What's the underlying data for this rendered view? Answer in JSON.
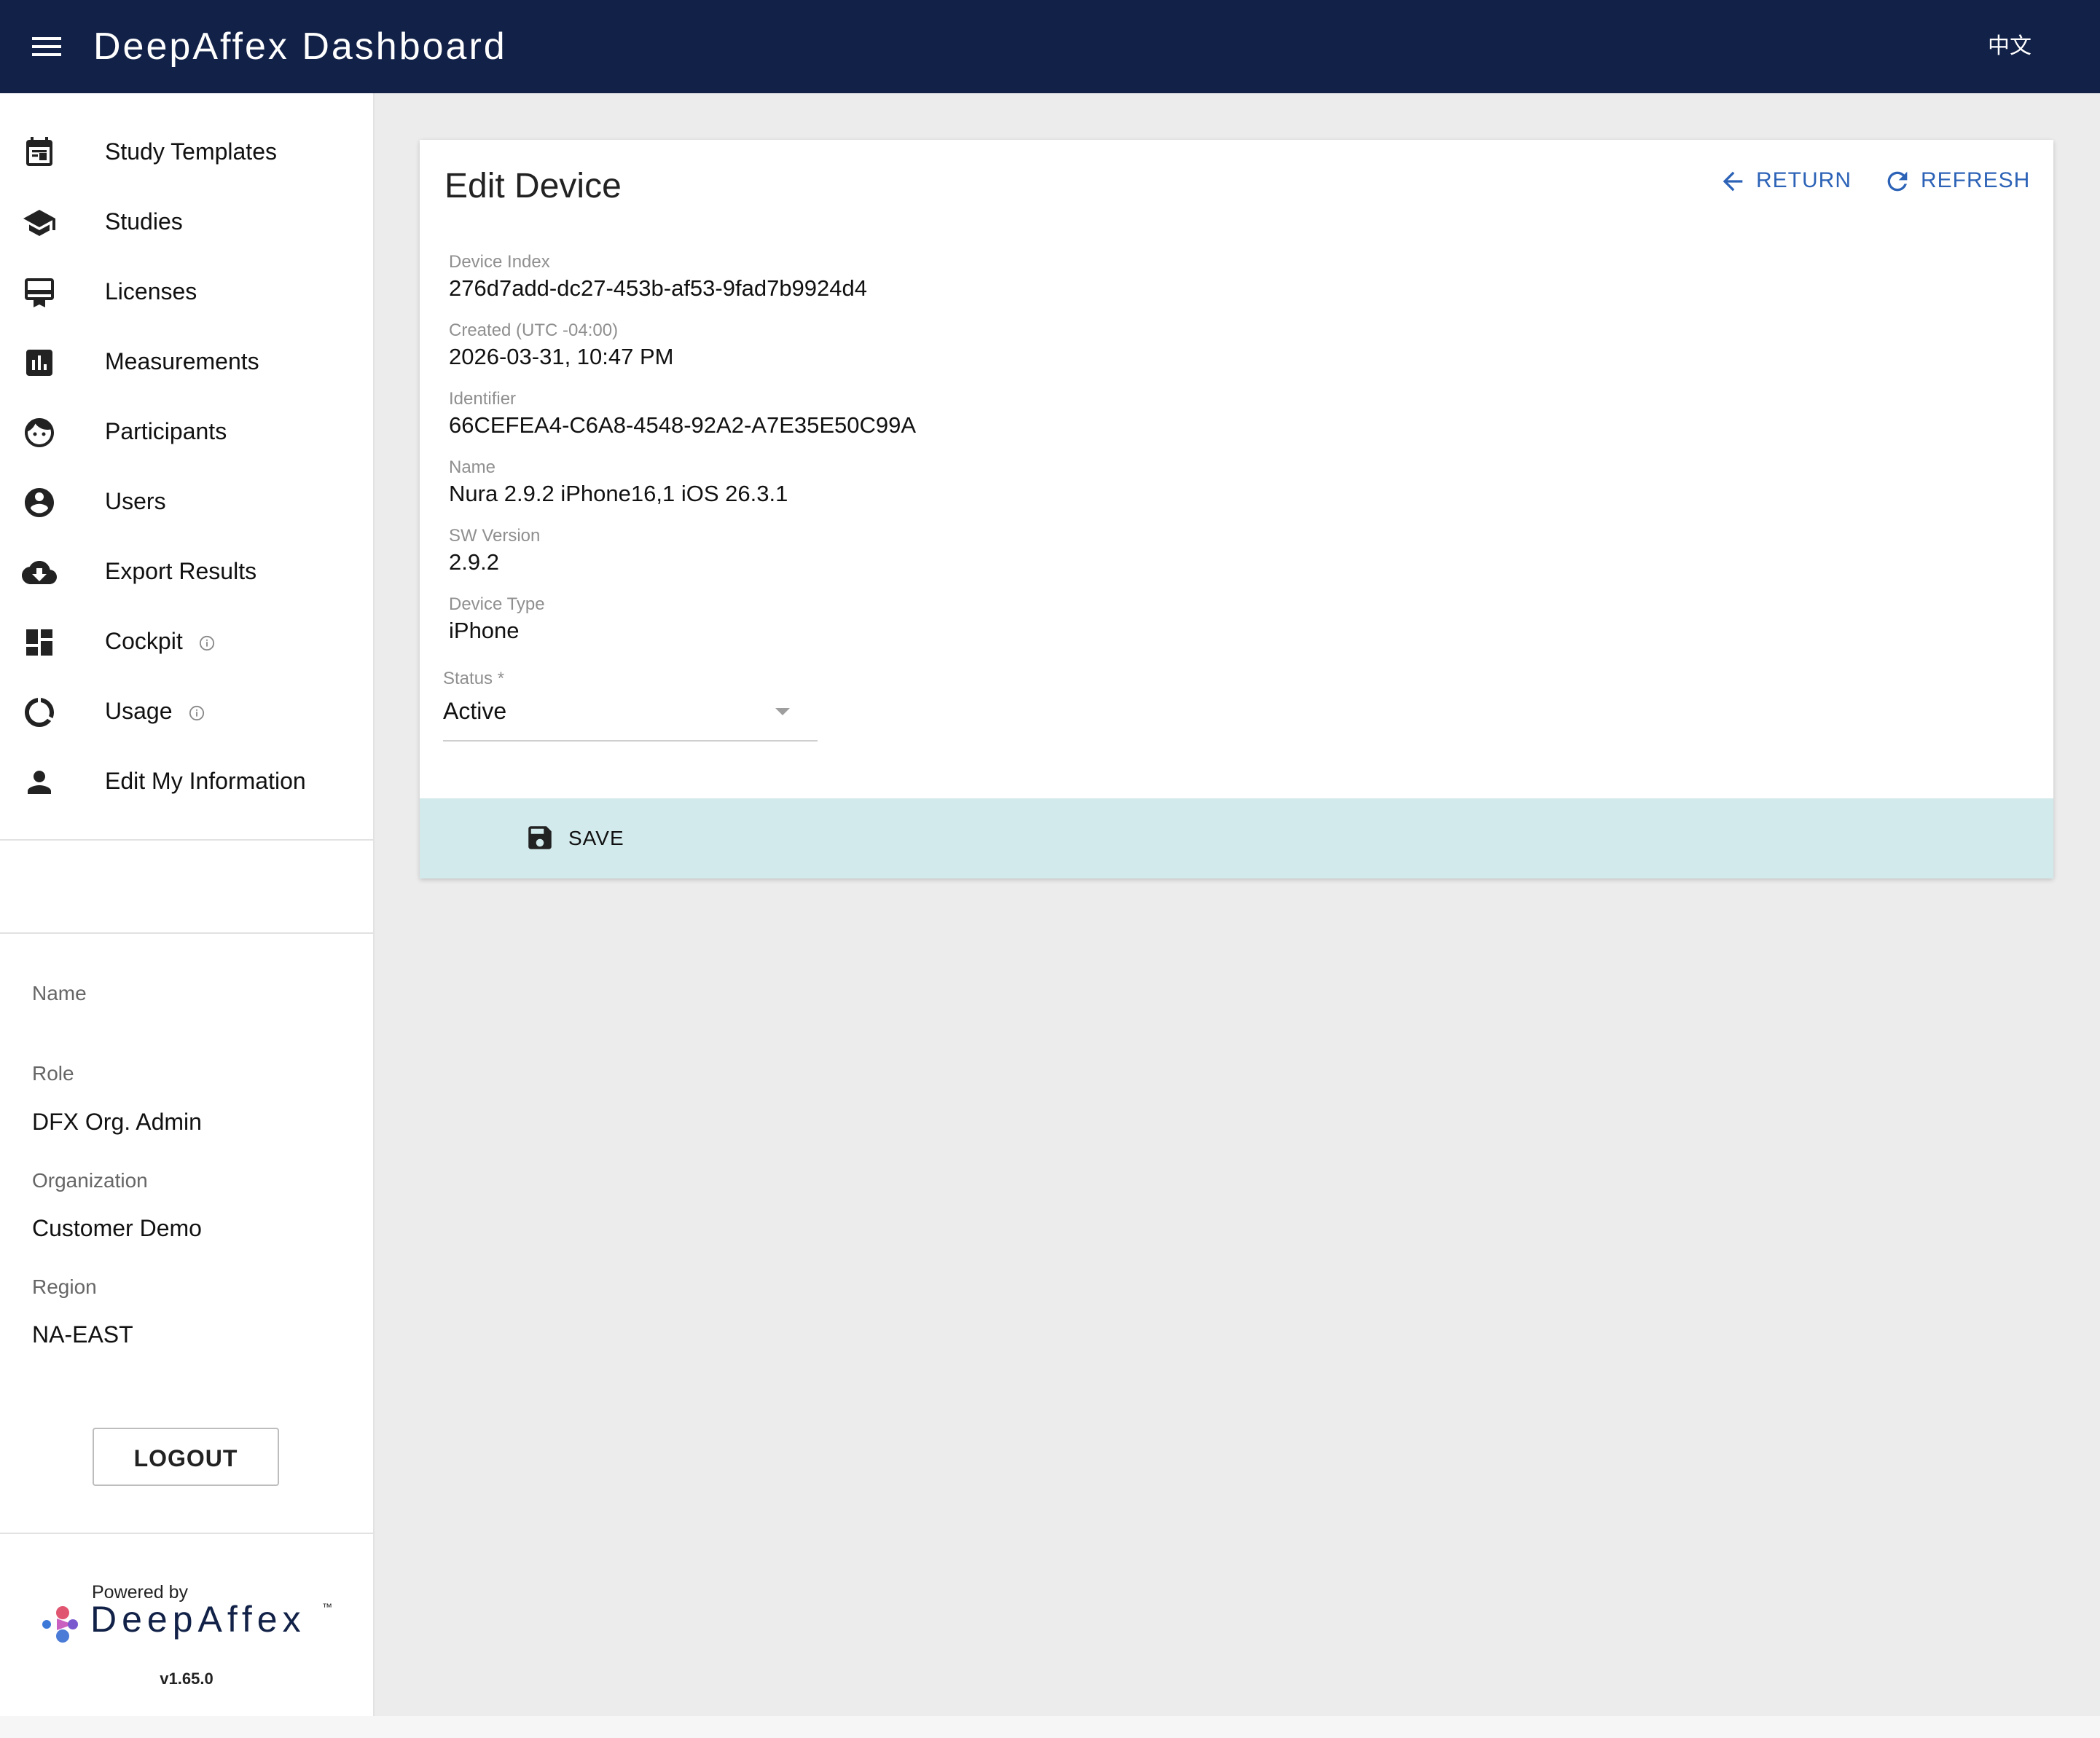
{
  "header": {
    "title": "DeepAffex Dashboard",
    "language_button": "中文",
    "background_color": "#122147"
  },
  "sidebar": {
    "items": [
      {
        "label": "Study Templates",
        "icon": "calendar-icon"
      },
      {
        "label": "Studies",
        "icon": "graduation-cap-icon"
      },
      {
        "label": "Licenses",
        "icon": "card-membership-icon"
      },
      {
        "label": "Measurements",
        "icon": "bar-chart-icon"
      },
      {
        "label": "Participants",
        "icon": "face-icon"
      },
      {
        "label": "Users",
        "icon": "account-circle-icon"
      },
      {
        "label": "Export Results",
        "icon": "cloud-download-icon"
      },
      {
        "label": "Cockpit",
        "icon": "dashboard-icon",
        "info": true
      },
      {
        "label": "Usage",
        "icon": "donut-icon",
        "info": true
      },
      {
        "label": "Edit My Information",
        "icon": "person-icon"
      }
    ],
    "user_info": {
      "name_label": "Name",
      "name_value": "",
      "role_label": "Role",
      "role_value": "DFX Org. Admin",
      "organization_label": "Organization",
      "organization_value": "Customer Demo",
      "region_label": "Region",
      "region_value": "NA-EAST"
    },
    "logout_label": "LOGOUT",
    "footer": {
      "powered_by": "Powered by",
      "brand": "DeepAffex",
      "trademark": "™",
      "version": "v1.65.0"
    }
  },
  "main": {
    "title": "Edit Device",
    "actions": {
      "return_label": "RETURN",
      "refresh_label": "REFRESH"
    },
    "fields": [
      {
        "label": "Device Index",
        "value": "276d7add-dc27-453b-af53-9fad7b9924d4"
      },
      {
        "label": "Created (UTC -04:00)",
        "value": "2026-03-31, 10:47 PM"
      },
      {
        "label": "Identifier",
        "value": "66CEFEA4-C6A8-4548-92A2-A7E35E50C99A"
      },
      {
        "label": "Name",
        "value": "Nura 2.9.2 iPhone16,1 iOS 26.3.1"
      },
      {
        "label": "SW Version",
        "value": "2.9.2"
      },
      {
        "label": "Device Type",
        "value": "iPhone"
      }
    ],
    "status": {
      "label": "Status *",
      "value": "Active"
    },
    "save_label": "SAVE",
    "accent_color": "#2d63b7",
    "footer_color": "#d3eaec"
  }
}
